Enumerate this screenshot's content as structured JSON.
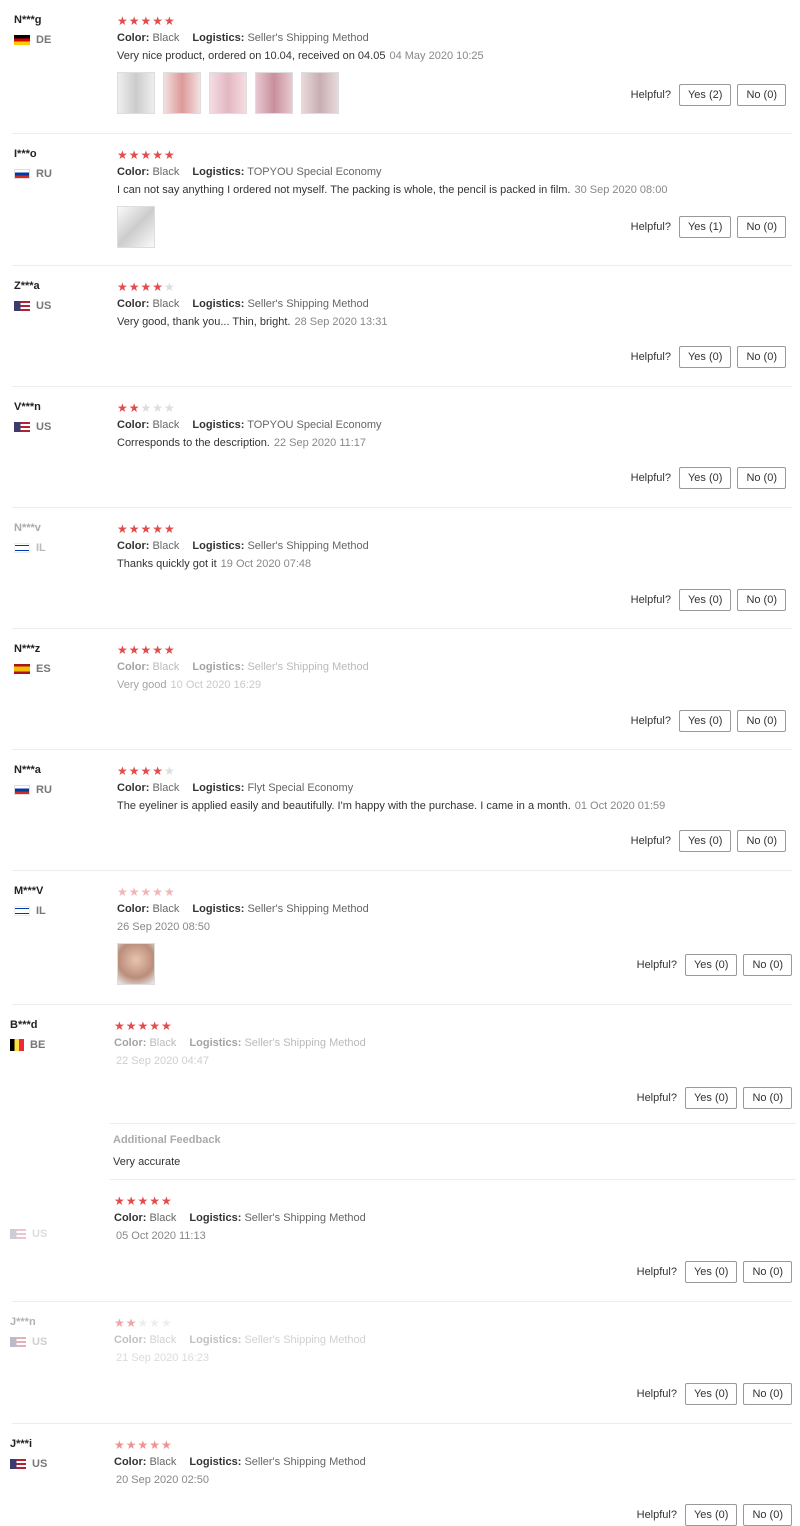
{
  "labels": {
    "color": "Color:",
    "logistics": "Logistics:",
    "helpful": "Helpful?"
  },
  "reviews": [
    {
      "name": "N***g",
      "country": "DE",
      "flag": [
        "#000000",
        "#dd0000",
        "#ffce00"
      ],
      "stars": 5,
      "color": "Black",
      "logistics": "Seller's Shipping Method",
      "text": "Very nice product, ordered on 10.04, received on 04.05",
      "date": "04 May 2020 10:25",
      "yes": "Yes (2)",
      "no": "No (0)",
      "photos": 5
    },
    {
      "name": "I***o",
      "country": "RU",
      "flag": [
        "#ffffff",
        "#0039a6",
        "#d52b1e"
      ],
      "stars": 5,
      "color": "Black",
      "logistics": "TOPYOU Special Economy",
      "text": "I can not say anything I ordered not myself. The packing is whole, the pencil is packed in film.",
      "date": "30 Sep 2020 08:00",
      "yes": "Yes (1)",
      "no": "No (0)",
      "photos": 1
    },
    {
      "name": "Z***a",
      "country": "US",
      "flag": [
        "#b22234",
        "#ffffff",
        "#3c3b6e"
      ],
      "stars": 4,
      "color": "Black",
      "logistics": "Seller's Shipping Method",
      "text": "Very good, thank you... Thin, bright.",
      "date": "28 Sep 2020 13:31",
      "yes": "Yes (0)",
      "no": "No (0)",
      "photos": 0
    },
    {
      "name": "V***n",
      "country": "US",
      "flag": [
        "#b22234",
        "#ffffff",
        "#3c3b6e"
      ],
      "stars": 2,
      "color": "Black",
      "logistics": "TOPYOU Special Economy",
      "text": "Corresponds to the description.",
      "date": "22 Sep 2020 11:17",
      "yes": "Yes (0)",
      "no": "No (0)",
      "photos": 0
    },
    {
      "name": "N***v",
      "country": "IL",
      "flag": [
        "#ffffff",
        "#0038b8",
        "#ffffff"
      ],
      "stars": 5,
      "color": "Black",
      "logistics": "Seller's Shipping Method",
      "text": "Thanks quickly got it",
      "date": "19 Oct 2020 07:48",
      "yes": "Yes (0)",
      "no": "No (0)",
      "photos": 0
    },
    {
      "name": "N***z",
      "country": "ES",
      "flag": [
        "#aa151b",
        "#f1bf00",
        "#aa151b"
      ],
      "stars": 5,
      "color": "Black",
      "logistics": "Seller's Shipping Method",
      "text": "Very good",
      "date": "10 Oct 2020 16:29",
      "yes": "Yes (0)",
      "no": "No (0)",
      "photos": 0
    },
    {
      "name": "N***a",
      "country": "RU",
      "flag": [
        "#ffffff",
        "#0039a6",
        "#d52b1e"
      ],
      "stars": 4,
      "color": "Black",
      "logistics": "Flyt Special Economy",
      "text": "The eyeliner is applied easily and beautifully. I'm happy with the purchase. I came in a month.",
      "date": "01 Oct 2020 01:59",
      "yes": "Yes (0)",
      "no": "No (0)",
      "photos": 0
    },
    {
      "name": "M***V",
      "country": "IL",
      "flag": [
        "#ffffff",
        "#0038b8",
        "#ffffff"
      ],
      "stars": 5,
      "color": "Black",
      "logistics": "Seller's Shipping Method",
      "text": "",
      "date": "26 Sep 2020 08:50",
      "yes": "Yes (0)",
      "no": "No (0)",
      "photos": 1
    },
    {
      "name": "B***d",
      "country": "BE",
      "flag": [
        "#000000",
        "#fae042",
        "#ed2939"
      ],
      "stars": 5,
      "color": "Black",
      "logistics": "Seller's Shipping Method",
      "text": "",
      "date": "22 Sep 2020 04:47",
      "yes": "Yes (0)",
      "no": "No (0)",
      "photos": 0
    },
    {
      "name": "",
      "country": "US",
      "flag": [
        "#b22234",
        "#ffffff",
        "#3c3b6e"
      ],
      "stars": 5,
      "color": "Black",
      "logistics": "Seller's Shipping Method",
      "text": "",
      "date": "05 Oct 2020 11:13",
      "yes": "Yes (0)",
      "no": "No (0)",
      "photos": 0
    },
    {
      "name": "J***n",
      "country": "US",
      "flag": [
        "#b22234",
        "#ffffff",
        "#3c3b6e"
      ],
      "stars": 2,
      "color": "Black",
      "logistics": "Seller's Shipping Method",
      "text": "",
      "date": "21 Sep 2020 16:23",
      "yes": "Yes (0)",
      "no": "No (0)",
      "photos": 0
    },
    {
      "name": "J***i",
      "country": "US",
      "flag": [
        "#b22234",
        "#ffffff",
        "#3c3b6e"
      ],
      "stars": 5,
      "color": "Black",
      "logistics": "Seller's Shipping Method",
      "text": "",
      "date": "20 Sep 2020 02:50",
      "yes": "Yes (0)",
      "no": "No (0)",
      "photos": 0
    }
  ],
  "additional_feedback": {
    "title": "Additional Feedback",
    "text": "Very accurate"
  }
}
